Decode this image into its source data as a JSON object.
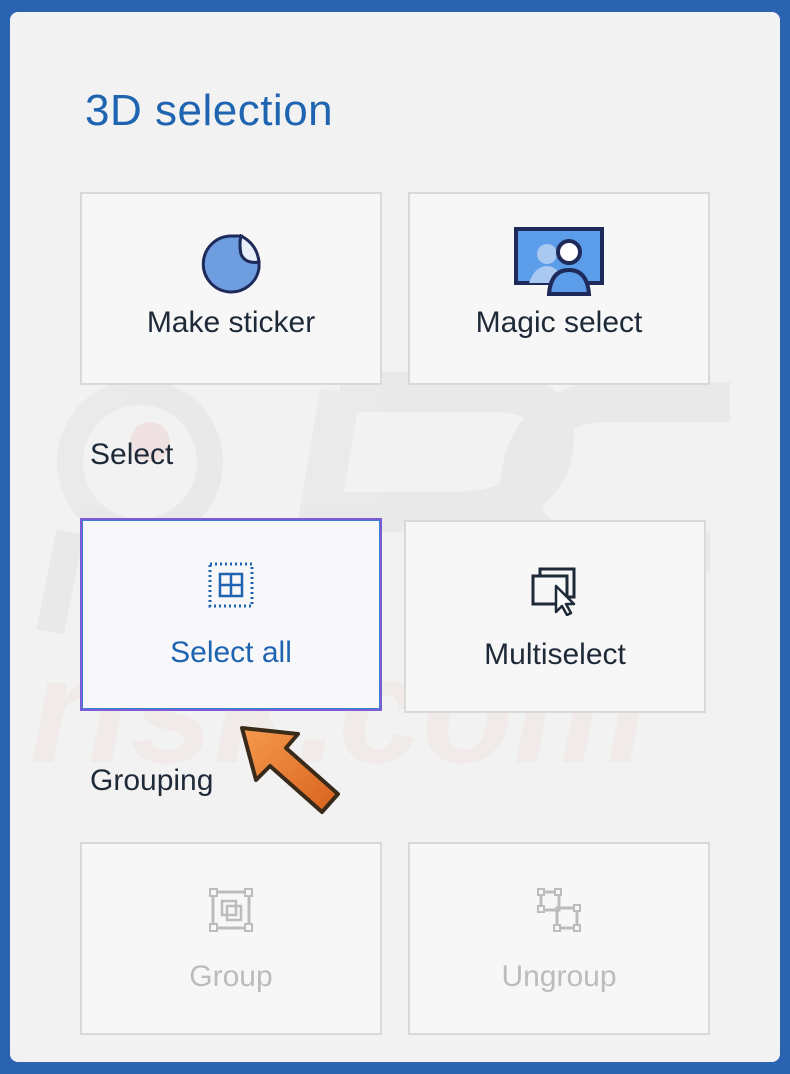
{
  "panel": {
    "title": "3D selection"
  },
  "sections": {
    "select_label": "Select",
    "grouping_label": "Grouping"
  },
  "tiles": {
    "make_sticker": "Make sticker",
    "magic_select": "Magic select",
    "select_all": "Select all",
    "multiselect": "Multiselect",
    "group": "Group",
    "ungroup": "Ungroup"
  },
  "state": {
    "selected_tile": "select_all",
    "disabled_tiles": [
      "group",
      "ungroup"
    ]
  },
  "colors": {
    "frame_border": "#2a64b0",
    "panel_background": "#f2f2f2",
    "accent": "#1f64b0",
    "selected_border": "#7a5cd6",
    "disabled_text": "#bcbcbc",
    "pointer_arrow": "#e8792f"
  },
  "icons": [
    "sticker-icon",
    "magic-select-icon",
    "select-all-icon",
    "multiselect-icon",
    "group-icon",
    "ungroup-icon",
    "pointer-arrow"
  ],
  "watermark": "PCrisk.com"
}
